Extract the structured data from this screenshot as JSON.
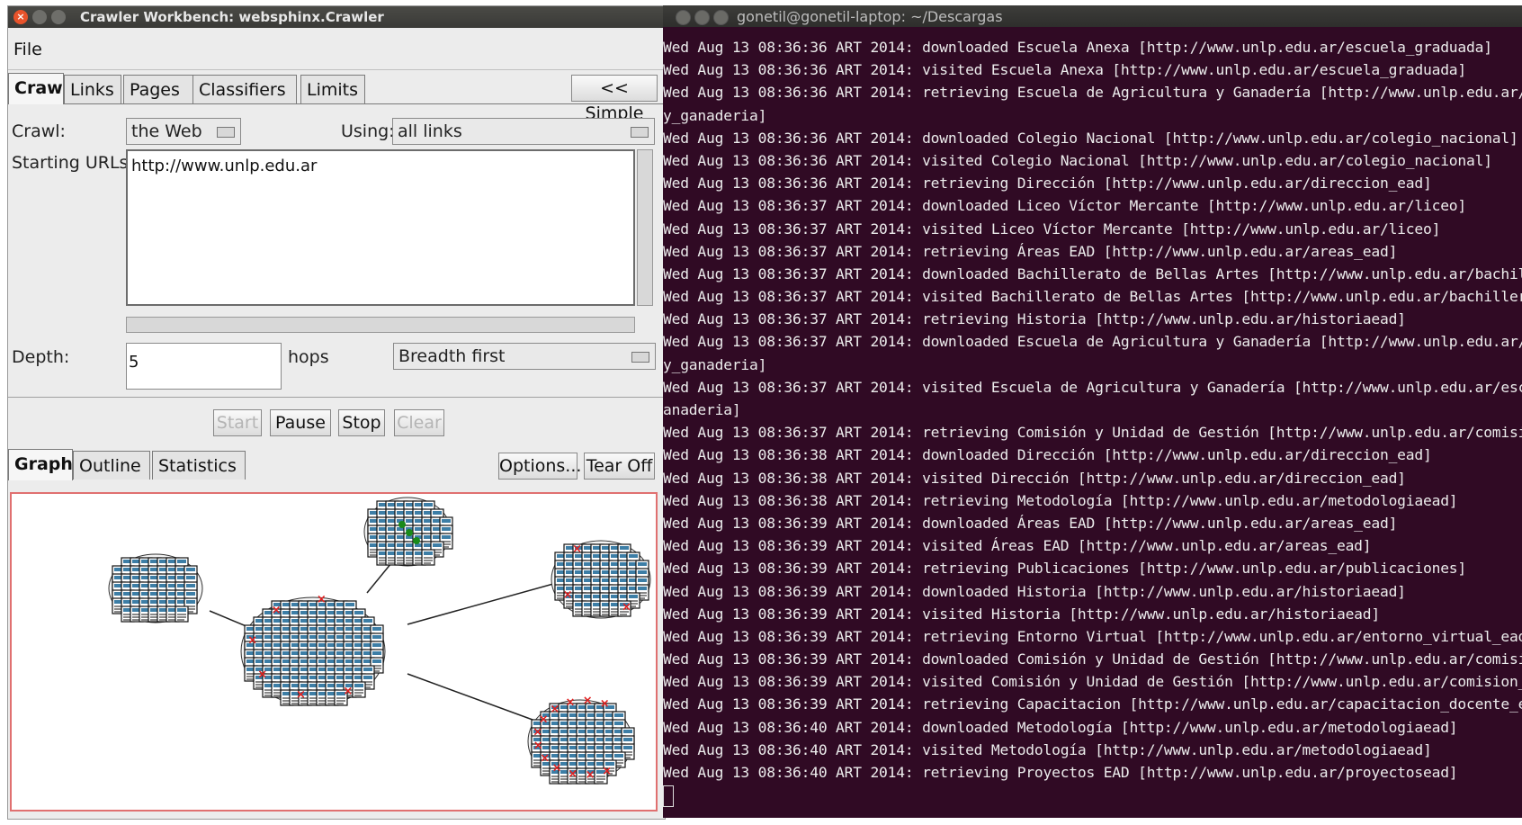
{
  "crawler": {
    "title": "Crawler Workbench: websphinx.Crawler",
    "menu": {
      "file": "File"
    },
    "tabs": [
      "Crawl",
      "Links",
      "Pages",
      "Classifiers",
      "Limits"
    ],
    "simple_button": "<< Simple",
    "crawl_label": "Crawl:",
    "crawl_value": "the Web",
    "using_label": "Using:",
    "using_value": "all links",
    "starting_urls_label": "Starting URLs:",
    "starting_urls_value": "http://www.unlp.edu.ar",
    "depth_label": "Depth:",
    "depth_value": "5",
    "hops_label": "hops",
    "search_order": "Breadth first",
    "buttons": {
      "start": "Start",
      "pause": "Pause",
      "stop": "Stop",
      "clear": "Clear"
    },
    "view_tabs": [
      "Graph",
      "Outline",
      "Statistics"
    ],
    "options_button": "Options...",
    "tearoff_button": "Tear Off"
  },
  "terminal": {
    "title": "gonetil@gonetil-laptop: ~/Descargas",
    "lines": [
      "Wed Aug 13 08:36:36 ART 2014: downloaded Escuela Anexa [http://www.unlp.edu.ar/escuela_graduada]",
      "Wed Aug 13 08:36:36 ART 2014: visited Escuela Anexa [http://www.unlp.edu.ar/escuela_graduada]",
      "Wed Aug 13 08:36:36 ART 2014: retrieving Escuela de Agricultura y Ganadería [http://www.unlp.edu.ar/escu",
      "y_ganaderia]",
      "Wed Aug 13 08:36:36 ART 2014: downloaded Colegio Nacional [http://www.unlp.edu.ar/colegio_nacional]",
      "Wed Aug 13 08:36:36 ART 2014: visited Colegio Nacional [http://www.unlp.edu.ar/colegio_nacional]",
      "Wed Aug 13 08:36:36 ART 2014: retrieving Dirección [http://www.unlp.edu.ar/direccion_ead]",
      "Wed Aug 13 08:36:37 ART 2014: downloaded Liceo Víctor Mercante [http://www.unlp.edu.ar/liceo]",
      "Wed Aug 13 08:36:37 ART 2014: visited Liceo Víctor Mercante [http://www.unlp.edu.ar/liceo]",
      "Wed Aug 13 08:36:37 ART 2014: retrieving Áreas EAD [http://www.unlp.edu.ar/areas_ead]",
      "Wed Aug 13 08:36:37 ART 2014: downloaded Bachillerato de Bellas Artes [http://www.unlp.edu.ar/bachillera",
      "Wed Aug 13 08:36:37 ART 2014: visited Bachillerato de Bellas Artes [http://www.unlp.edu.ar/bachillerato_",
      "Wed Aug 13 08:36:37 ART 2014: retrieving Historia [http://www.unlp.edu.ar/historiaead]",
      "Wed Aug 13 08:36:37 ART 2014: downloaded Escuela de Agricultura y Ganadería [http://www.unlp.edu.ar/escu",
      "y_ganaderia]",
      "Wed Aug 13 08:36:37 ART 2014: visited Escuela de Agricultura y Ganadería [http://www.unlp.edu.ar/escuela",
      "anaderia]",
      "Wed Aug 13 08:36:37 ART 2014: retrieving Comisión y Unidad de Gestión [http://www.unlp.edu.ar/comision_y",
      "Wed Aug 13 08:36:38 ART 2014: downloaded Dirección [http://www.unlp.edu.ar/direccion_ead]",
      "Wed Aug 13 08:36:38 ART 2014: visited Dirección [http://www.unlp.edu.ar/direccion_ead]",
      "Wed Aug 13 08:36:38 ART 2014: retrieving Metodología [http://www.unlp.edu.ar/metodologiaead]",
      "Wed Aug 13 08:36:39 ART 2014: downloaded Áreas EAD [http://www.unlp.edu.ar/areas_ead]",
      "Wed Aug 13 08:36:39 ART 2014: visited Áreas EAD [http://www.unlp.edu.ar/areas_ead]",
      "Wed Aug 13 08:36:39 ART 2014: retrieving Publicaciones [http://www.unlp.edu.ar/publicaciones]",
      "Wed Aug 13 08:36:39 ART 2014: downloaded Historia [http://www.unlp.edu.ar/historiaead]",
      "Wed Aug 13 08:36:39 ART 2014: visited Historia [http://www.unlp.edu.ar/historiaead]",
      "Wed Aug 13 08:36:39 ART 2014: retrieving Entorno Virtual [http://www.unlp.edu.ar/entorno_virtual_ead]",
      "Wed Aug 13 08:36:39 ART 2014: downloaded Comisión y Unidad de Gestión [http://www.unlp.edu.ar/comision_y",
      "Wed Aug 13 08:36:39 ART 2014: visited Comisión y Unidad de Gestión [http://www.unlp.edu.ar/comision_y_un",
      "Wed Aug 13 08:36:39 ART 2014: retrieving Capacitacion [http://www.unlp.edu.ar/capacitacion_docente_ead]",
      "Wed Aug 13 08:36:40 ART 2014: downloaded Metodología [http://www.unlp.edu.ar/metodologiaead]",
      "Wed Aug 13 08:36:40 ART 2014: visited Metodología [http://www.unlp.edu.ar/metodologiaead]",
      "Wed Aug 13 08:36:40 ART 2014: retrieving Proyectos EAD [http://www.unlp.edu.ar/proyectosead]"
    ]
  },
  "colors": {
    "terminal_bg": "#300a24",
    "graph_border": "#e07070",
    "error_mark": "#e02020",
    "visited_mark": "#1a8a1a"
  }
}
